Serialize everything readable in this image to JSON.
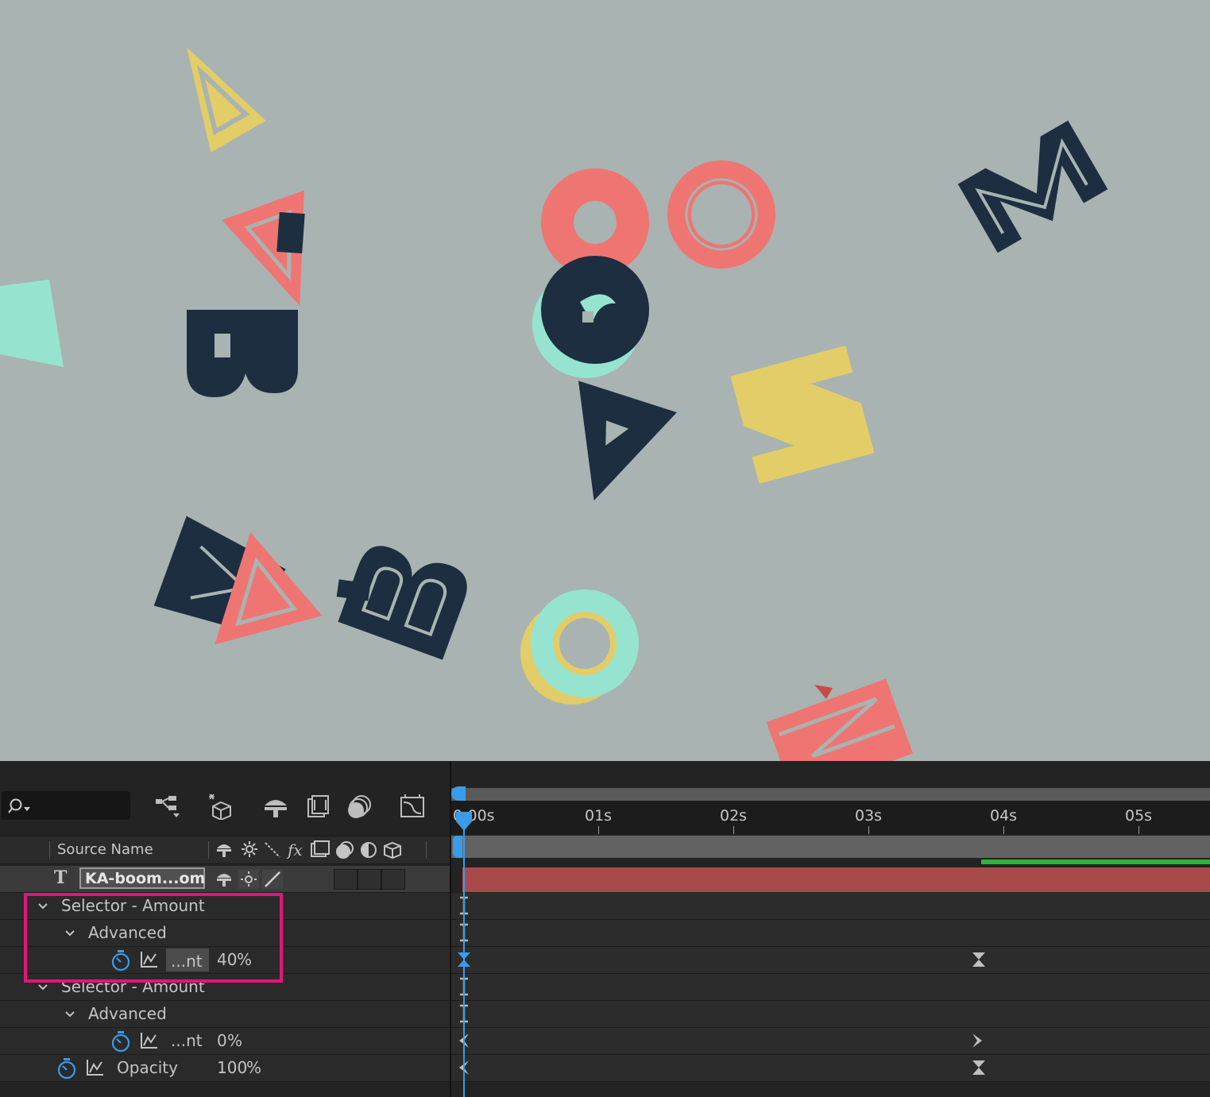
{
  "timeline": {
    "search_placeholder": "",
    "column_header": "Source Name",
    "layer_name": "KA-boom...om",
    "layer_type_glyph": "T",
    "ruler": [
      "0:00s",
      "01s",
      "02s",
      "03s",
      "04s",
      "05s"
    ],
    "rows": [
      {
        "label": "Selector - Amount"
      },
      {
        "label": "Advanced"
      },
      {
        "prop": "...nt",
        "value": "40",
        "unit": "%"
      },
      {
        "label": "Selector - Amount"
      },
      {
        "label": "Advanced"
      },
      {
        "prop": "...nt",
        "value": "0",
        "unit": "%"
      },
      {
        "prop": "Opacity",
        "value": "100",
        "unit": "%"
      }
    ]
  },
  "colors": {
    "accent_blue": "#3a9be9",
    "highlight": "#e0177b",
    "layer_bar": "#a84a4a",
    "work_area": "#2fb43a",
    "bg_canvas": "#a9b3b1"
  }
}
